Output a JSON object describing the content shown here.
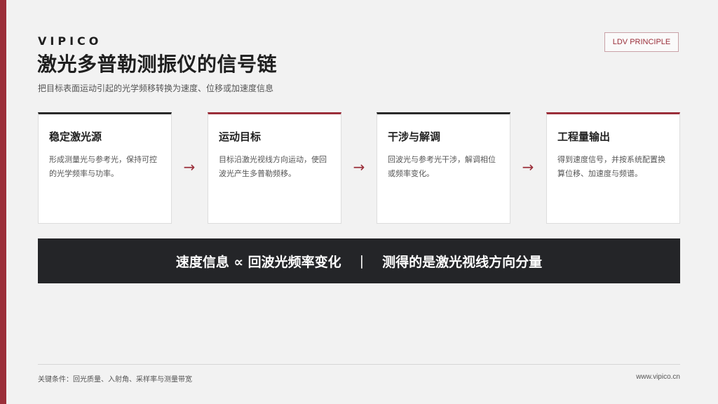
{
  "header": {
    "brand": "VIPICO",
    "title": "激光多普勒测振仪的信号链",
    "subtitle": "把目标表面运动引起的光学频移转换为速度、位移或加速度信息",
    "tag": "LDV PRINCIPLE"
  },
  "colors": {
    "accent": "#9b2f3a",
    "dark": "#242528",
    "background": "#f2f2f2"
  },
  "steps": [
    {
      "title": "稳定激光源",
      "body": "形成测量光与参考光，保持可控的光学频率与功率。"
    },
    {
      "title": "运动目标",
      "body": "目标沿激光视线方向运动，使回波光产生多普勒频移。"
    },
    {
      "title": "干涉与解调",
      "body": "回波光与参考光干涉，解调相位或频率变化。"
    },
    {
      "title": "工程量输出",
      "body": "得到速度信号，并按系统配置换算位移、加速度与频谱。"
    }
  ],
  "arrows": [
    "→",
    "→",
    "→"
  ],
  "banner": {
    "left": "速度信息 ∝ 回波光频率变化",
    "separator": "|",
    "right": "测得的是激光视线方向分量"
  },
  "footer": {
    "note": "关键条件：回光质量、入射角、采样率与测量带宽",
    "url": "www.vipico.cn"
  }
}
